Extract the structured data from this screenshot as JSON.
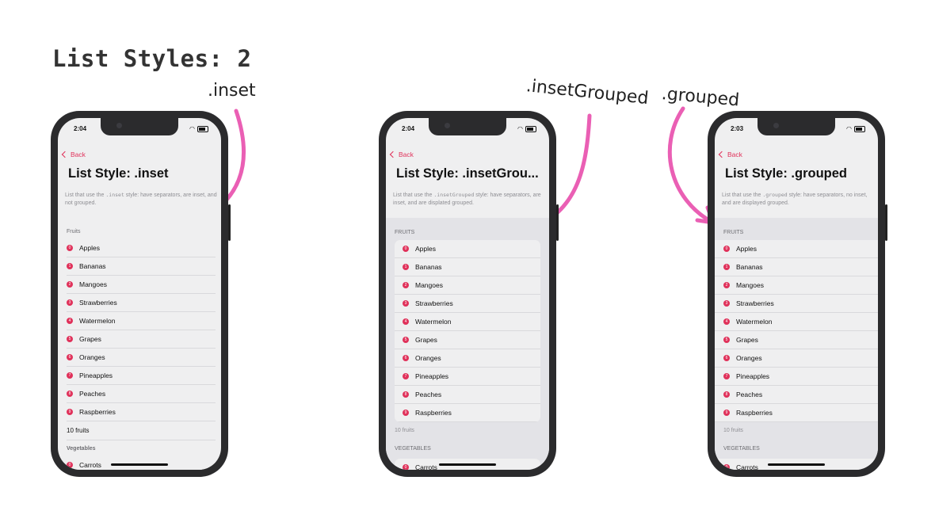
{
  "slide_title": "List Styles: 2",
  "annotations": {
    "inset": ".inset",
    "insetGrouped": ".insetGrouped",
    "grouped": ".grouped"
  },
  "accent_color": "#e0315a",
  "arrow_color": "#ea5fb4",
  "phones": [
    {
      "time": "2:04",
      "back": "Back",
      "title": "List Style: .inset",
      "desc_pre": "List that use the ",
      "desc_code": ".inset",
      "desc_post": " style: have separators, are inset, and not grouped.",
      "fruits_header": "Fruits",
      "fruits": [
        "Apples",
        "Bananas",
        "Mangoes",
        "Strawberries",
        "Watermelon",
        "Grapes",
        "Oranges",
        "Pineapples",
        "Peaches",
        "Raspberries"
      ],
      "fruits_footer": "10 fruits",
      "veg_header": "Vegetables",
      "veg_first": "Carrots"
    },
    {
      "time": "2:04",
      "back": "Back",
      "title": "List Style: .insetGrou...",
      "desc_pre": "List that use the ",
      "desc_code": ".insetGrouped",
      "desc_post": " style: have separators, are inset, and are displated grouped.",
      "fruits_header": "FRUITS",
      "fruits": [
        "Apples",
        "Bananas",
        "Mangoes",
        "Strawberries",
        "Watermelon",
        "Grapes",
        "Oranges",
        "Pineapples",
        "Peaches",
        "Raspberries"
      ],
      "fruits_footer": "10 fruits",
      "veg_header": "VEGETABLES",
      "veg_first": "Carrots"
    },
    {
      "time": "2:03",
      "back": "Back",
      "title": "List Style: .grouped",
      "desc_pre": "List that use the ",
      "desc_code": ".grouped",
      "desc_post": " style: have separators, no inset, and are displayed grouped.",
      "fruits_header": "FRUITS",
      "fruits": [
        "Apples",
        "Bananas",
        "Mangoes",
        "Strawberries",
        "Watermelon",
        "Grapes",
        "Oranges",
        "Pineapples",
        "Peaches",
        "Raspberries"
      ],
      "fruits_footer": "10 fruits",
      "veg_header": "VEGETABLES",
      "veg_first": "Carrots"
    }
  ]
}
